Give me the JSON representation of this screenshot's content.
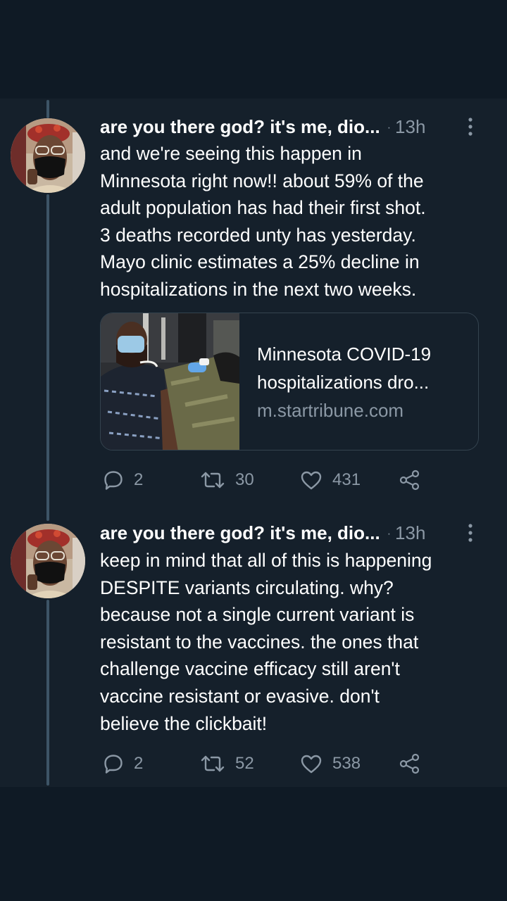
{
  "thread": {
    "tweets": [
      {
        "author_name": "are you there god? it's me, dio...",
        "time": "13h",
        "body_lines": [
          "and we're seeing this happen in",
          "Minnesota right now!! about 59% of the",
          "adult population has had their first shot.",
          "3 deaths recorded unty has yesterday.",
          "Mayo clinic estimates a 25% decline in",
          "hospitalizations in the next two weeks."
        ],
        "link_card": {
          "title_lines": [
            "Minnesota COVID-19",
            "hospitalizations dro..."
          ],
          "domain": "m.startribune.com"
        },
        "actions": {
          "replies": "2",
          "retweets": "30",
          "likes": "431"
        }
      },
      {
        "author_name": "are you there god? it's me, dio...",
        "time": "13h",
        "body_lines": [
          "keep in mind that all of this is happening",
          "DESPITE variants circulating. why?",
          "because not a single current variant is",
          "resistant to the vaccines. the ones that",
          "challenge vaccine efficacy still aren't",
          "vaccine resistant or evasive. don't",
          "believe the clickbait!"
        ],
        "actions": {
          "replies": "2",
          "retweets": "52",
          "likes": "538"
        }
      }
    ]
  },
  "colors": {
    "background": "#15202b",
    "outer_background": "#0f1a25",
    "text_primary": "#ffffff",
    "text_secondary": "#8b98a5",
    "thread_line": "#3d5466",
    "card_border": "#34434f"
  },
  "icons": {
    "reply": "speech-bubble-icon",
    "retweet": "retweet-arrows-icon",
    "like": "heart-icon",
    "share": "share-nodes-icon",
    "more": "vertical-ellipsis-icon"
  }
}
